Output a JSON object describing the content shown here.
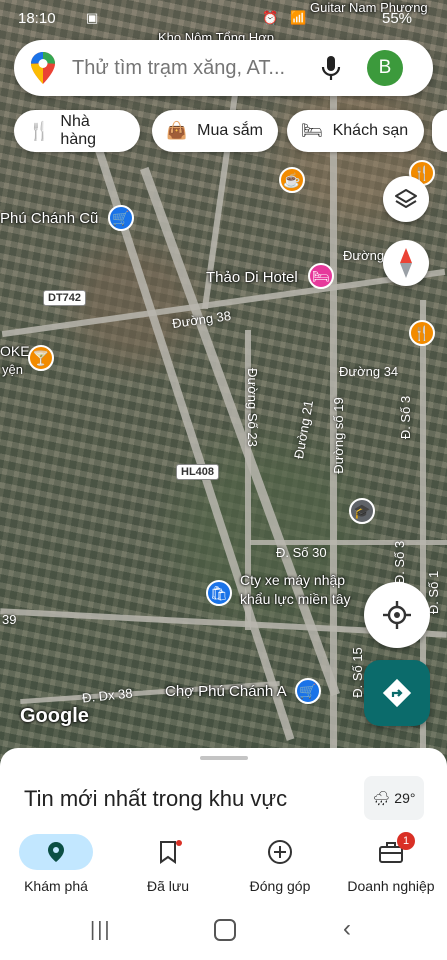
{
  "status_bar": {
    "time": "18:10",
    "battery": "55%"
  },
  "search": {
    "placeholder": "Thử tìm trạm xăng, AT...",
    "avatar_letter": "B"
  },
  "chips": [
    {
      "label": "Nhà hàng",
      "icon": "fork-knife-icon"
    },
    {
      "label": "Mua sắm",
      "icon": "shopping-bag-icon"
    },
    {
      "label": "Khách sạn",
      "icon": "bed-icon"
    }
  ],
  "map_labels": {
    "top_area": "Kho Nôm Tổng Hợp",
    "guitar": "Guitar Nam Phương",
    "phu_chanh_cu": "Phú Chánh Cũ",
    "hotel": "Thảo Di Hotel",
    "oke": "OKE",
    "oke_sub": "yện",
    "cty_line1": "Cty xe máy nhập",
    "cty_line2": "khẩu lực miền tây",
    "cho": "Chợ Phú Chánh A",
    "google": "Google"
  },
  "road_labels": {
    "duong38": "Đường 38",
    "duong_so23": "Đường Số 23",
    "duong21": "Đường 21",
    "duong_so19": "Đường số 19",
    "duong34": "Đường 34",
    "duong_top": "Đường",
    "d_so30": "Đ. Số 30",
    "d_so3_a": "Đ. Số 3",
    "d_so3_b": "Đ. Số 3",
    "d_so1": "Đ. Số 1",
    "d_so15": "Đ. Số 15",
    "d_dx38": "Đ. Dx 38",
    "n39": "39"
  },
  "shields": {
    "dt742": "DT742",
    "hl408": "HL408"
  },
  "sheet": {
    "title": "Tin mới nhất trong khu vực",
    "temperature": "29°"
  },
  "bottom_nav": [
    {
      "label": "Khám phá",
      "icon": "explore-pin-icon",
      "active": true
    },
    {
      "label": "Đã lưu",
      "icon": "bookmark-icon",
      "active": false
    },
    {
      "label": "Đóng góp",
      "icon": "add-circle-icon",
      "active": false
    },
    {
      "label": "Doanh nghiệp",
      "icon": "business-icon",
      "active": false,
      "badge": "1"
    }
  ],
  "colors": {
    "accent": "#1a73e8",
    "active_pill": "#c2e7ff",
    "poi_orange": "#f28b00",
    "poi_blue": "#1a73e8",
    "poi_pink": "#e6399b",
    "directions": "#0b6b6b",
    "avatar": "#3c9a3c"
  }
}
